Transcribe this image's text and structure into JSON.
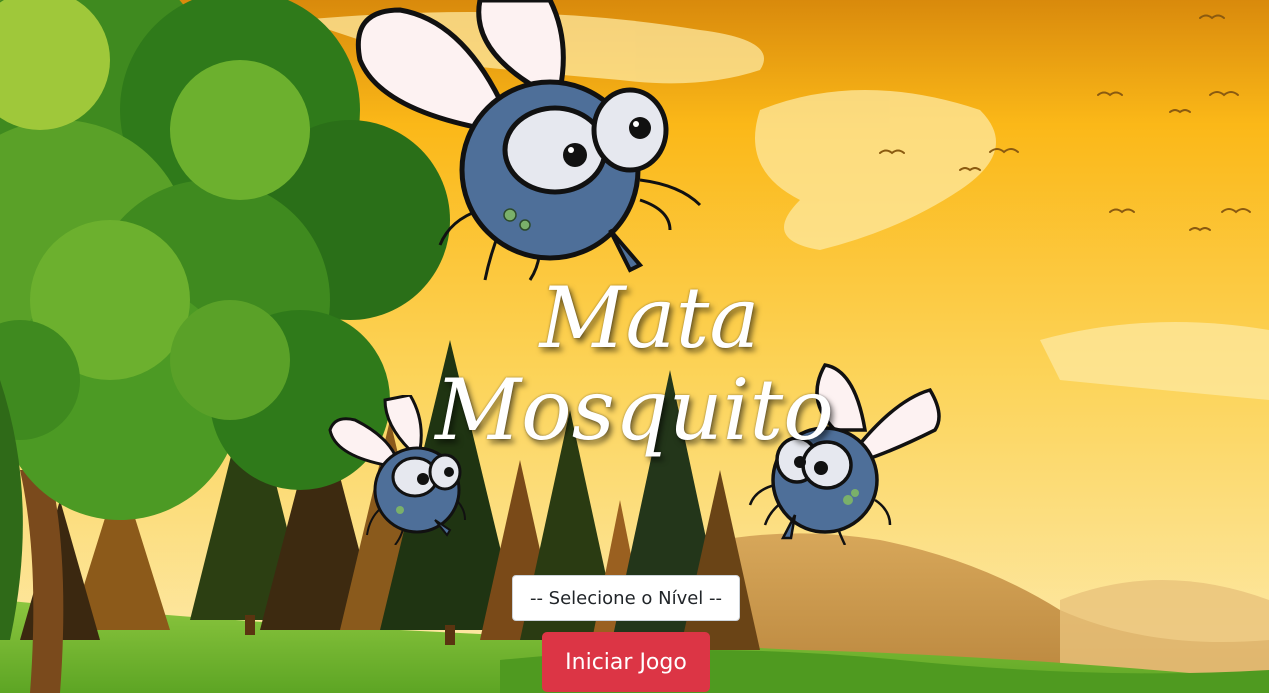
{
  "title": {
    "line1": "Mata",
    "line2": "Mosquito"
  },
  "level_select": {
    "selected": "-- Selecione o Nível --"
  },
  "start_button": {
    "label": "Iniciar Jogo"
  },
  "colors": {
    "sky_top": "#e8960e",
    "sky_mid": "#fbc02d",
    "sky_bottom": "#fde9a6",
    "grass": "#6fb327",
    "tree_green": "#4f9a2a",
    "mosquito_body": "#4e6f99",
    "button_red": "#dc3545"
  },
  "icons": [
    "mosquito-icon",
    "bird-icon",
    "tree-icon"
  ]
}
